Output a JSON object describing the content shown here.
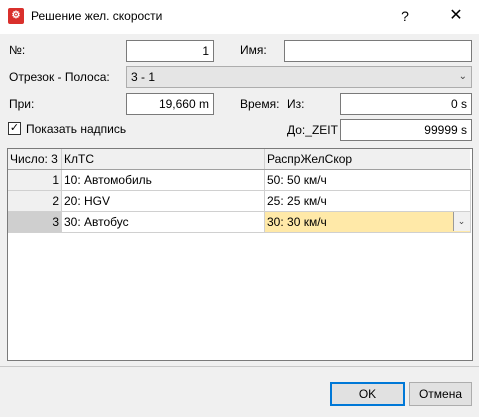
{
  "window": {
    "title": "Решение жел. скорости",
    "icon_text": "⚙",
    "help": "?",
    "close": "✕"
  },
  "form": {
    "no_label": "№:",
    "no_value": "1",
    "name_label": "Имя:",
    "name_value": "",
    "segment_label": "Отрезок - Полоса:",
    "segment_value": "3 - 1",
    "at_label": "При:",
    "at_value": "19,660 m",
    "time_label": "Время:",
    "from_label": "Из:",
    "from_value": "0 s",
    "show_label": "Показать надпись",
    "show_checked": "✓",
    "to_label": "До:_ZEIT",
    "to_value": "99999 s"
  },
  "table": {
    "headers": {
      "count": "Число: 3",
      "vehicle_class": "КлТС",
      "speed_dist": "РаспрЖелСкор"
    },
    "rows": [
      {
        "num": "1",
        "vehicle_class": "10: Автомобиль",
        "speed_dist": "50: 50 км/ч"
      },
      {
        "num": "2",
        "vehicle_class": "20: HGV",
        "speed_dist": "25: 25 км/ч"
      },
      {
        "num": "3",
        "vehicle_class": "30: Автобус",
        "speed_dist": "30: 30 км/ч"
      }
    ]
  },
  "buttons": {
    "ok": "OK",
    "cancel": "Отмена"
  }
}
